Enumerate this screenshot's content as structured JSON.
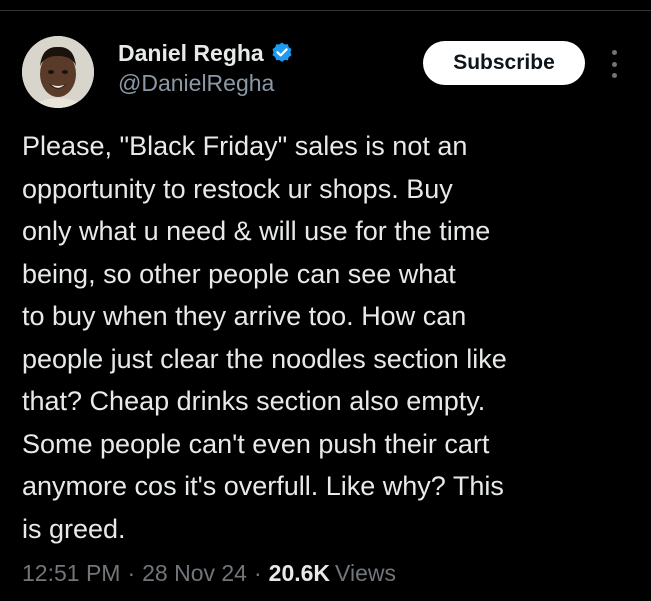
{
  "author": {
    "display_name": "Daniel Regha",
    "handle": "@DanielRegha",
    "verified_color": "#1d9bf0"
  },
  "actions": {
    "subscribe_label": "Subscribe",
    "more_icon": "more-vertical-icon"
  },
  "tweet": {
    "lines": [
      "Please, \"Black Friday\" sales is not an",
      "opportunity to restock ur shops. Buy",
      "only what u need & will use for the time",
      "being, so other people can see what",
      "to buy when they arrive too. How can",
      "people just clear the noodles section like",
      "that? Cheap drinks section also empty.",
      "Some people can't even push their cart",
      "anymore cos it's overfull. Like why? This",
      "is greed."
    ]
  },
  "meta": {
    "time": "12:51 PM",
    "separator": "·",
    "date": "28 Nov 24",
    "views_count": "20.6K",
    "views_label": "Views"
  },
  "colors": {
    "background": "#000000",
    "text": "#e7e9ea",
    "secondary_text": "#71767b",
    "button_bg": "#ffffff"
  }
}
